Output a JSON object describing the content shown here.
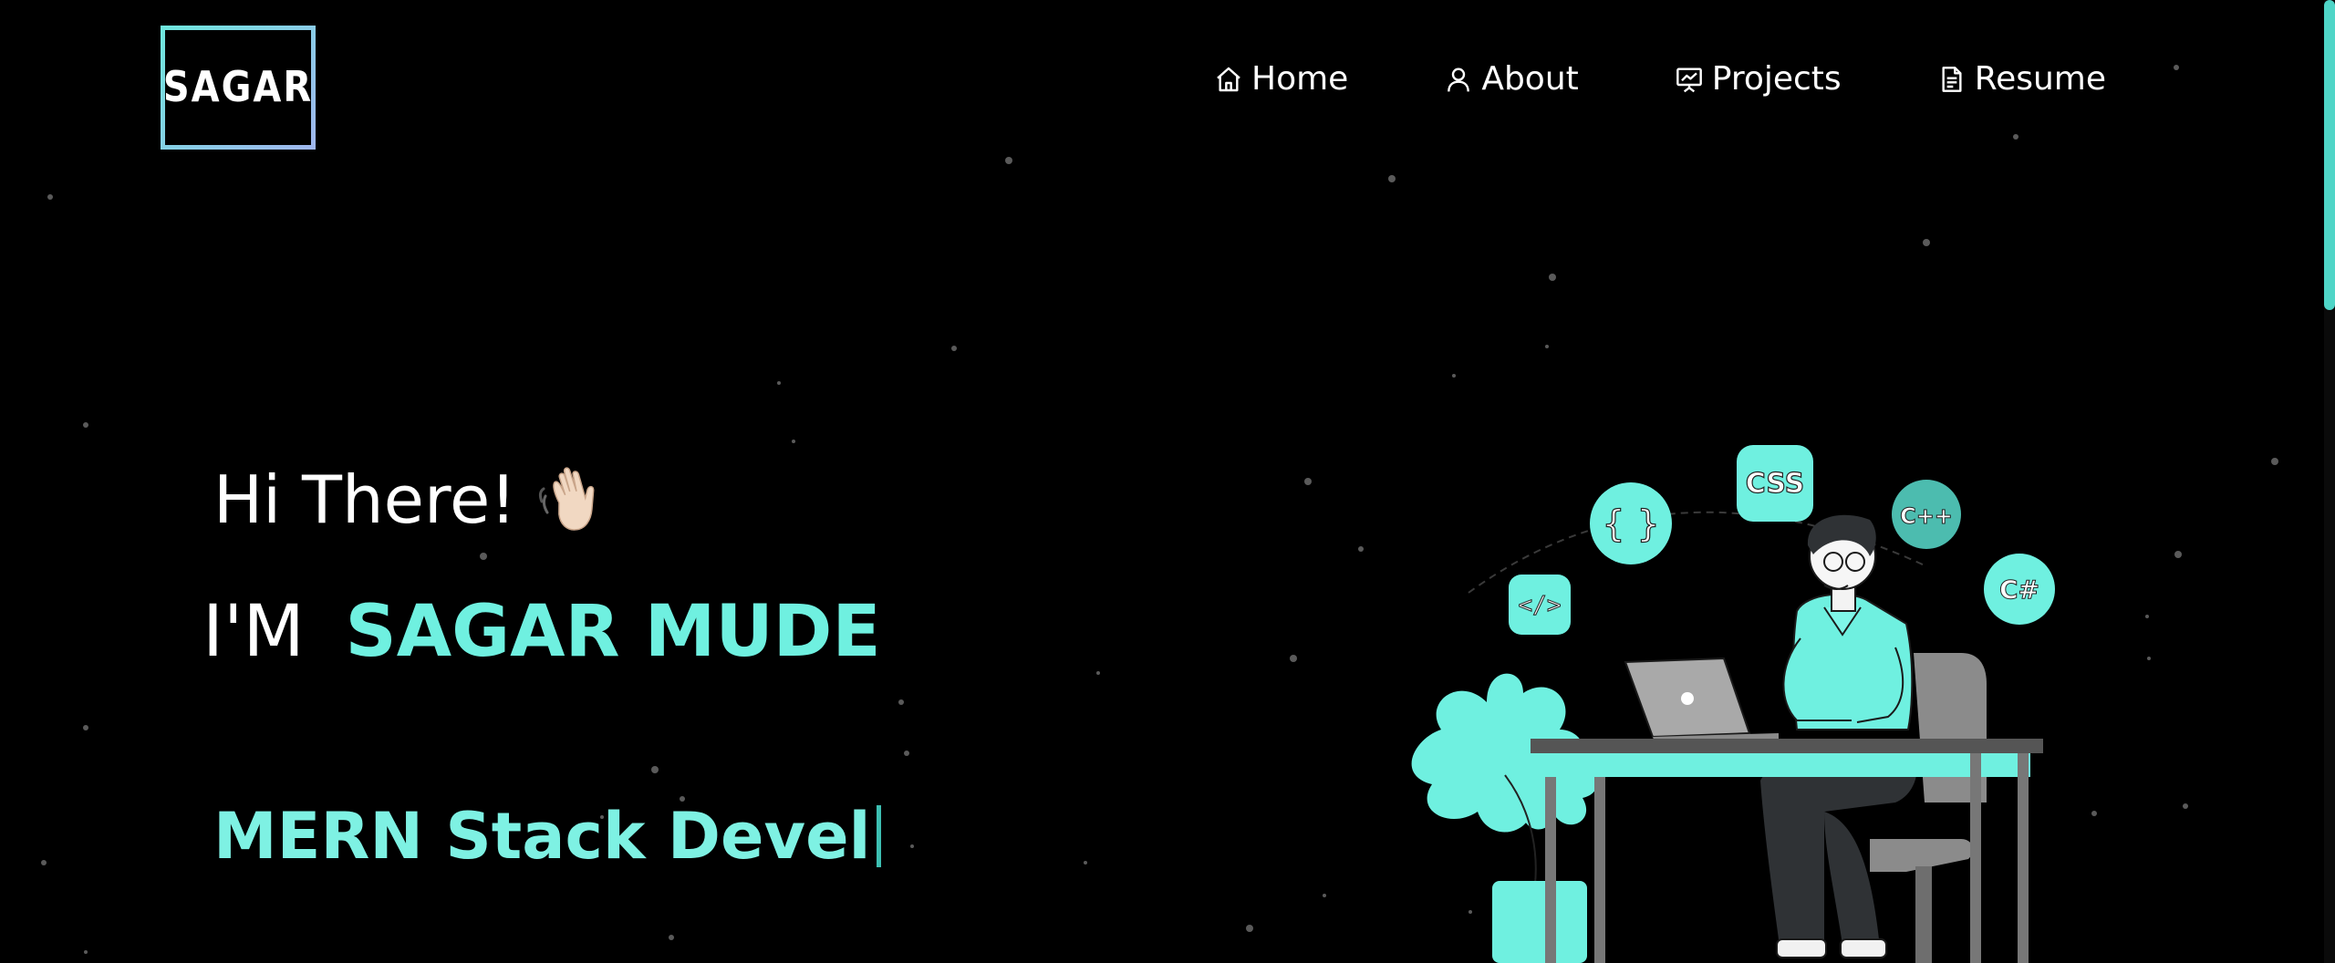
{
  "logo": {
    "text": "SAGAR"
  },
  "nav": {
    "items": [
      {
        "label": "Home",
        "icon": "home-icon"
      },
      {
        "label": "About",
        "icon": "user-icon"
      },
      {
        "label": "Projects",
        "icon": "presentation-icon"
      },
      {
        "label": "Resume",
        "icon": "document-icon"
      }
    ]
  },
  "hero": {
    "greeting": "Hi There!",
    "greeting_icon": "waving-hand-icon",
    "intro_prefix": "I'M",
    "name": "SAGAR MUDE",
    "typed_text": "MERN Stack Devel"
  },
  "illustration": {
    "badges": [
      "</>",
      "{ }",
      "CSS",
      "C++",
      "C#"
    ]
  },
  "colors": {
    "accent": "#6ff0e0",
    "background": "#000000",
    "scrollbar": "#4fd5c7"
  }
}
